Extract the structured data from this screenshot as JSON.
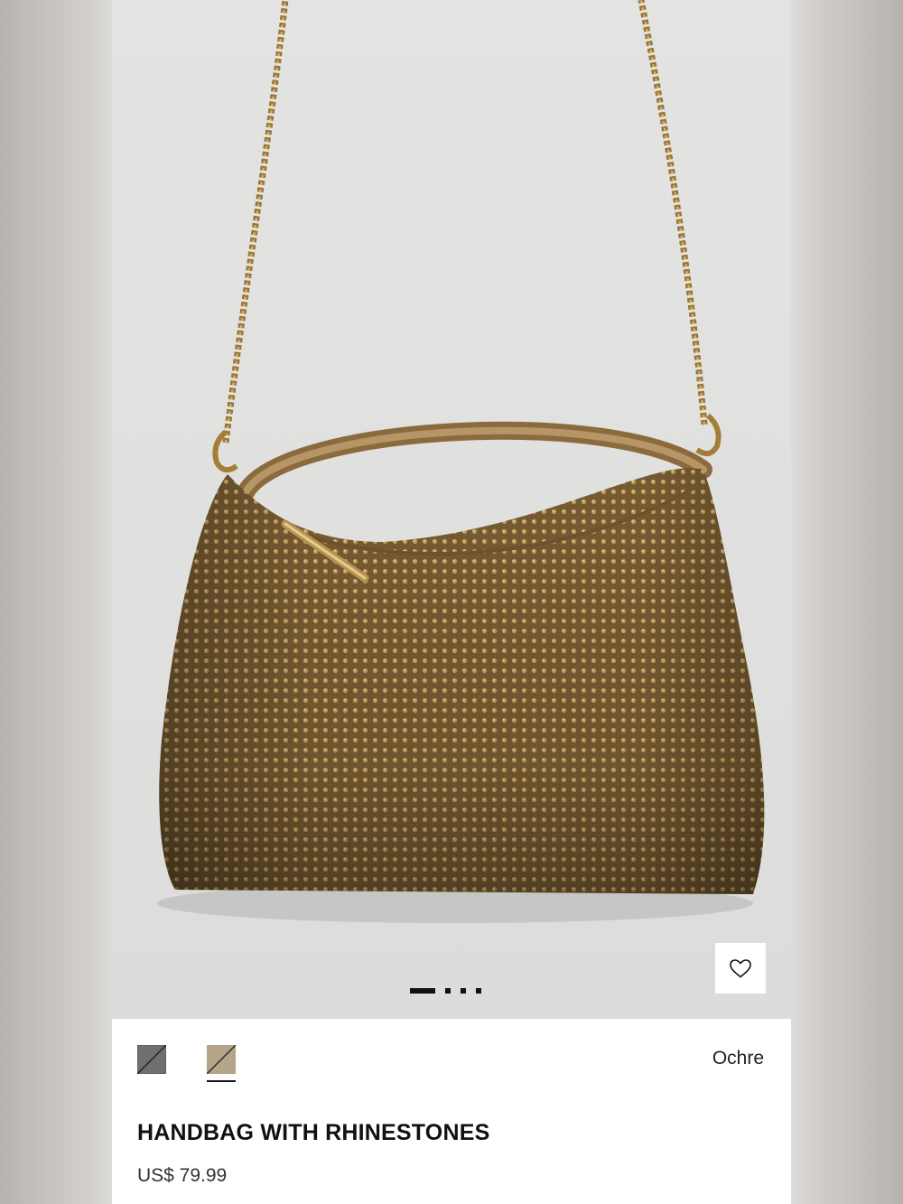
{
  "product": {
    "title": "HANDBAG WITH RHINESTONES",
    "price": "US$ 79.99",
    "selected_color": "Ochre",
    "image_subject": "rhinestone-handbag-photo"
  },
  "gallery": {
    "image_count": 4,
    "active_index": 0
  },
  "swatches": [
    {
      "name": "grey-swatch",
      "color": "#6f6f6f",
      "selected": false
    },
    {
      "name": "ochre-swatch",
      "color": "#b4a488",
      "selected": true
    }
  ],
  "icons": {
    "favorite": "heart-icon"
  },
  "colors": {
    "bag_body": "#8a6a3c",
    "chain_gold": "#b08a3e",
    "background_gray": "#dcdcdb"
  }
}
